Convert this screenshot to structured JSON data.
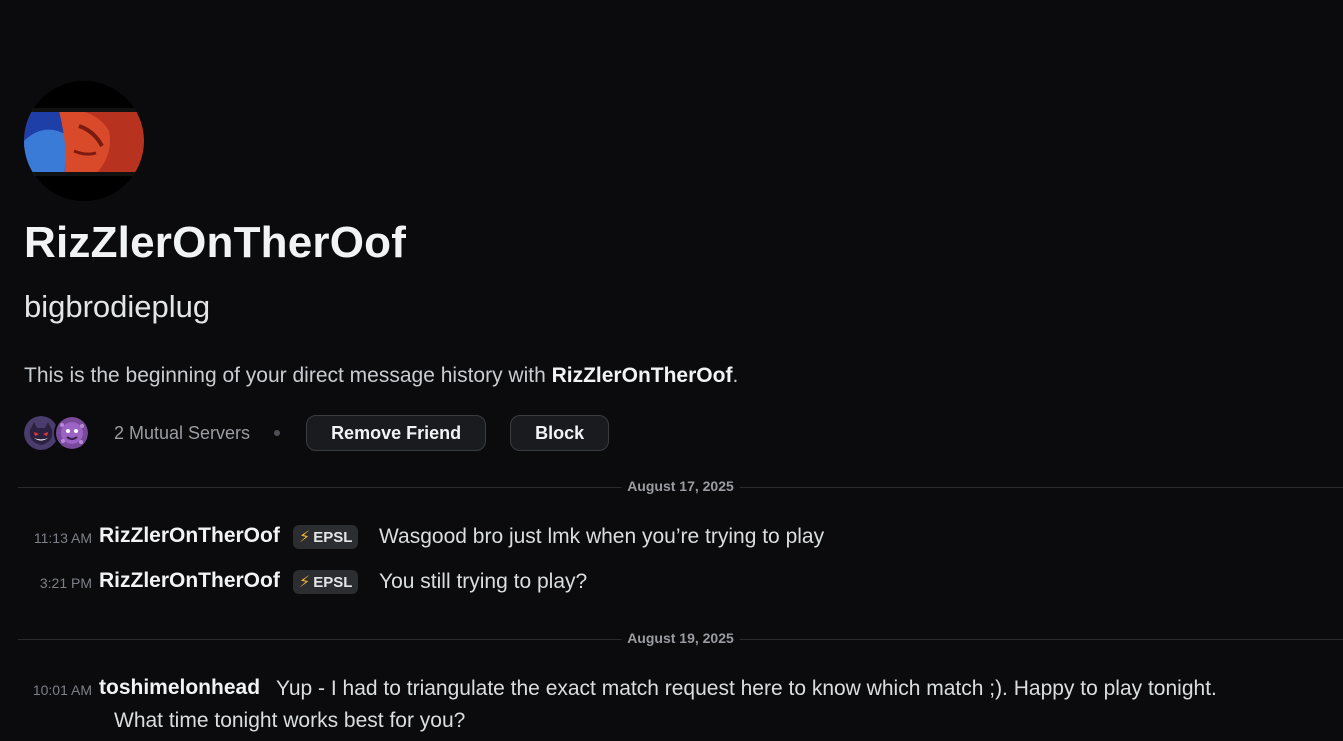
{
  "profile": {
    "display_name": "RizZlerOnTherOof",
    "username": "bigbrodieplug",
    "intro_prefix": "This is the beginning of your direct message history with ",
    "intro_name": "RizZlerOnTherOof",
    "intro_suffix": ".",
    "mutual_servers": "2 Mutual Servers",
    "remove_friend": "Remove Friend",
    "block": "Block"
  },
  "dates": [
    "August 17, 2025",
    "August 19, 2025"
  ],
  "messages": [
    {
      "time": "11:13 AM",
      "author": "RizZlerOnTherOof",
      "tag": "EPSL",
      "text": "Wasgood bro just lmk when you’re trying to play"
    },
    {
      "time": "3:21 PM",
      "author": "RizZlerOnTherOof",
      "tag": "EPSL",
      "text": "You still trying to play?"
    },
    {
      "time": "10:01 AM",
      "author": "toshimelonhead",
      "text": "Yup - I had to triangulate the exact match request here to know which match ;). Happy to play tonight.",
      "text2": "What time tonight works best for you?"
    }
  ],
  "colors": {
    "background": "#0b0b0d",
    "tag_icon": "#f0b232"
  },
  "icons": [
    "avatar",
    "gengar-server-icon",
    "koffing-server-icon",
    "lightning-icon"
  ]
}
